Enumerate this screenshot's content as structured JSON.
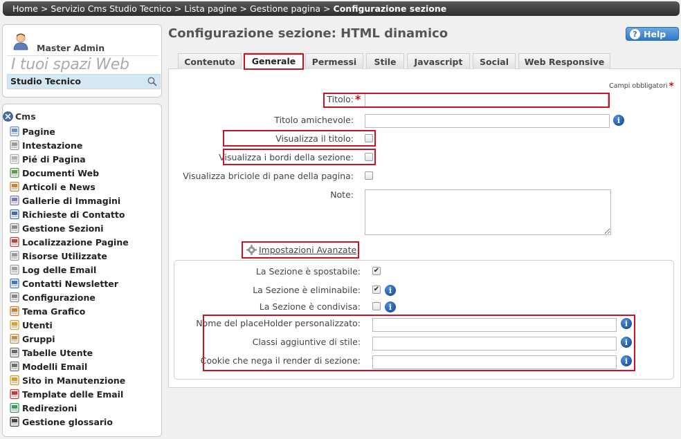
{
  "breadcrumb": {
    "items": [
      "Home",
      "Servizio Cms Studio Tecnico",
      "Lista pagine",
      "Gestione pagina"
    ],
    "current": "Configurazione sezione",
    "separator": ">"
  },
  "user": {
    "name": "Master Admin",
    "spaces_title": "I tuoi spazi Web",
    "selected_space": "Studio Tecnico"
  },
  "menu": {
    "root": "Cms",
    "items": [
      {
        "label": "Pagine",
        "icon": "page-icon"
      },
      {
        "label": "Intestazione",
        "icon": "header-icon"
      },
      {
        "label": "Pié di Pagina",
        "icon": "footer-icon"
      },
      {
        "label": "Documenti Web",
        "icon": "web-document-icon"
      },
      {
        "label": "Articoli e News",
        "icon": "news-icon"
      },
      {
        "label": "Gallerie di Immagini",
        "icon": "image-gallery-icon"
      },
      {
        "label": "Richieste di Contatto",
        "icon": "contact-request-icon"
      },
      {
        "label": "Gestione Sezioni",
        "icon": "sections-icon"
      },
      {
        "label": "Localizzazione Pagine",
        "icon": "localization-icon"
      },
      {
        "label": "Risorse Utilizzate",
        "icon": "resources-icon"
      },
      {
        "label": "Log delle Email",
        "icon": "email-log-icon"
      },
      {
        "label": "Contatti Newsletter",
        "icon": "newsletter-contacts-icon"
      },
      {
        "label": "Configurazione",
        "icon": "gear-icon"
      },
      {
        "label": "Tema Grafico",
        "icon": "palette-icon"
      },
      {
        "label": "Utenti",
        "icon": "user-icon"
      },
      {
        "label": "Gruppi",
        "icon": "group-icon"
      },
      {
        "label": "Tabelle Utente",
        "icon": "table-icon"
      },
      {
        "label": "Modelli Email",
        "icon": "email-template-icon"
      },
      {
        "label": "Sito in Manutenzione",
        "icon": "maintenance-icon"
      },
      {
        "label": "Template delle Email",
        "icon": "mail-icon"
      },
      {
        "label": "Redirezioni",
        "icon": "redirect-icon"
      },
      {
        "label": "Gestione glossario",
        "icon": "glossary-icon"
      }
    ]
  },
  "page": {
    "title": "Configurazione sezione: HTML dinamico",
    "help_label": "Help"
  },
  "tabs": [
    {
      "label": "Contenuto",
      "active": false
    },
    {
      "label": "Generale",
      "active": true
    },
    {
      "label": "Permessi",
      "active": false
    },
    {
      "label": "Stile",
      "active": false
    },
    {
      "label": "Javascript",
      "active": false
    },
    {
      "label": "Social",
      "active": false
    },
    {
      "label": "Web Responsive",
      "active": false
    }
  ],
  "form": {
    "required_note": "Campi obbligatori",
    "required_marker": "*",
    "titolo_label": "Titolo:",
    "titolo_value": "",
    "titolo_amichevole_label": "Titolo amichevole:",
    "titolo_amichevole_value": "",
    "visualizza_titolo_label": "Visualizza il titolo:",
    "visualizza_titolo_checked": false,
    "visualizza_bordi_label": "Visualizza i bordi della sezione:",
    "visualizza_bordi_checked": false,
    "briciole_label": "Visualizza briciole di pane della pagina:",
    "briciole_checked": false,
    "note_label": "Note:",
    "note_value": ""
  },
  "advanced": {
    "link_label": "Impostazioni Avanzate",
    "spostabile_label": "La Sezione è spostabile:",
    "spostabile_checked": true,
    "eliminabile_label": "La Sezione è eliminabile:",
    "eliminabile_checked": true,
    "condivisa_label": "La Sezione è condivisa:",
    "condivisa_checked": false,
    "placeholder_label": "Nome del placeHolder personalizzato:",
    "placeholder_value": "",
    "classi_label": "Classi aggiuntive di stile:",
    "classi_value": "",
    "cookie_label": "Cookie che nega il render di sezione:",
    "cookie_value": ""
  },
  "colors": {
    "highlight": "#cc1122",
    "required": "#cc1111",
    "help_button": "#2f77c4",
    "space_select_bg": "#d6e7f4"
  }
}
